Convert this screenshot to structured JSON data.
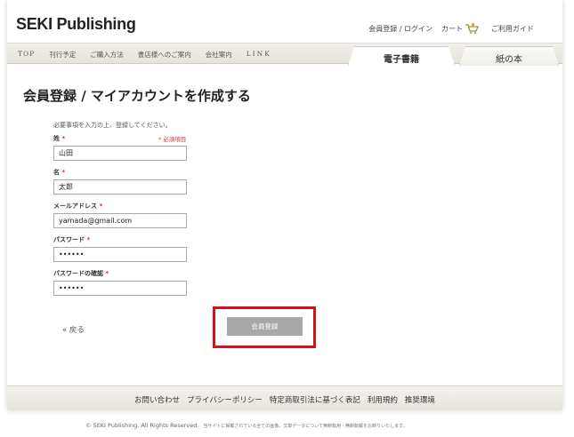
{
  "header": {
    "logo": "SEKI Publishing",
    "login": "会員登録 / ログイン",
    "cart": "カート",
    "guide": "ご利用ガイド"
  },
  "nav": {
    "links": [
      "TOP",
      "刊行予定",
      "ご購入方法",
      "書店様へのご案内",
      "会社案内",
      "LINK"
    ],
    "tabs": {
      "ebook": "電子書籍",
      "paper": "紙の本"
    }
  },
  "page": {
    "title": "会員登録 / マイアカウントを作成する",
    "intro": "必要事項を入力の上、登録してください。",
    "required_note": "* 必須項目",
    "req_mark": "*"
  },
  "form": {
    "last_name": {
      "label": "姓",
      "value": "山田"
    },
    "first_name": {
      "label": "名",
      "value": "太郎"
    },
    "email": {
      "label": "メールアドレス",
      "value": "yamada@gmail.com"
    },
    "password": {
      "label": "パスワード",
      "value": "••••••"
    },
    "password_confirm": {
      "label": "パスワードの確認",
      "value": "••••••"
    }
  },
  "actions": {
    "back": "« 戻る",
    "submit": "会員登録"
  },
  "footer": {
    "links": [
      "お問い合わせ",
      "プライバシーポリシー",
      "特定商取引法に基づく表記",
      "利用規約",
      "推奨環境"
    ],
    "copyright": "© SEKI Publishing. All Rights Reserved.",
    "notice": "当サイトに掲載されている全ての画像、文章データについて無断転用・無断転載をお断りいたします。"
  },
  "colors": {
    "required": "#d0342c",
    "highlight": "#d41414",
    "button": "#a8a8a8"
  }
}
